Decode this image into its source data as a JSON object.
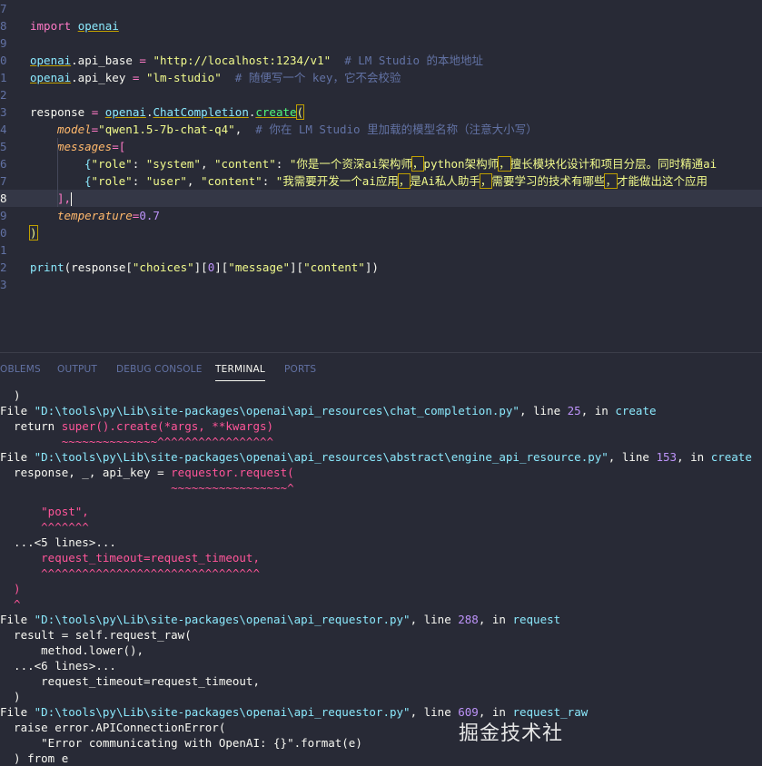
{
  "editor": {
    "lines": [
      {
        "num": "7"
      },
      {
        "num": "8",
        "tokens": {
          "kw": "import",
          "mod": "openai"
        }
      },
      {
        "num": "9"
      },
      {
        "num": "0",
        "tokens": {
          "obj": "openai",
          "attr": ".api_base",
          "eq": " = ",
          "str": "\"http://localhost:1234/v1\"",
          "cmt": "  # LM Studio 的本地地址"
        }
      },
      {
        "num": "1",
        "tokens": {
          "obj": "openai",
          "attr": ".api_key",
          "eq": " = ",
          "str": "\"lm-studio\"",
          "cmt": "  # 随便写一个 key，它不会校验"
        }
      },
      {
        "num": "2"
      },
      {
        "num": "3",
        "tokens": {
          "var": "response",
          "eq": " = ",
          "obj": "openai",
          "dot": ".",
          "cls": "ChatCompletion",
          "dot2": ".",
          "fn": "create",
          "open": "("
        }
      },
      {
        "num": "4",
        "tokens": {
          "param": "model",
          "eq": "=",
          "str": "\"qwen1.5-7b-chat-q4\"",
          "comma": ",",
          "cmt": "  # 你在 LM Studio 里加载的模型名称（注意大小写）"
        }
      },
      {
        "num": "5",
        "tokens": {
          "param": "messages",
          "eq": "=",
          "open": "["
        }
      },
      {
        "num": "6",
        "tokens": {
          "open": "{",
          "k1": "\"role\"",
          "c1": ": ",
          "v1": "\"system\"",
          "s1": ", ",
          "k2": "\"content\"",
          "c2": ": ",
          "v2": "\"你是一个资深ai架构师",
          "v2b": "，",
          "v2c": "python架构师",
          "v2d": "，",
          "v2e": "擅长模块化设计和项目分层。同时精通ai"
        }
      },
      {
        "num": "7",
        "tokens": {
          "open": "{",
          "k1": "\"role\"",
          "c1": ": ",
          "v1": "\"user\"",
          "s1": ", ",
          "k2": "\"content\"",
          "c2": ": ",
          "v2": "\"我需要开发一个ai应用",
          "v2b": "，",
          "v2c": "是Ai私人助手",
          "v2d": "，",
          "v2e": "需要学习的技术有哪些",
          "v2f": "，",
          "v2g": "才能做出这个应用"
        }
      },
      {
        "num": "8",
        "tokens": {
          "close": "],"
        }
      },
      {
        "num": "9",
        "tokens": {
          "param": "temperature",
          "eq": "=",
          "num": "0.7"
        }
      },
      {
        "num": "0",
        "tokens": {
          "close": ")"
        }
      },
      {
        "num": "1"
      },
      {
        "num": "2",
        "tokens": {
          "fn": "print",
          "rest": "(response[",
          "s1": "\"choices\"",
          "b1": "][",
          "n0": "0",
          "b2": "][",
          "s2": "\"message\"",
          "b3": "][",
          "s3": "\"content\"",
          "b4": "])"
        }
      },
      {
        "num": "3"
      }
    ]
  },
  "panel": {
    "tabs": [
      "OBLEMS",
      "OUTPUT",
      "DEBUG CONSOLE",
      "TERMINAL",
      "PORTS"
    ],
    "active_tab": "TERMINAL"
  },
  "terminal": {
    "l1": "  )",
    "l2_a": "File ",
    "l2_path": "\"D:\\tools\\py\\Lib\\site-packages\\openai\\api_resources\\chat_completion.py\"",
    "l2_b": ", line ",
    "l2_num": "25",
    "l2_c": ", in ",
    "l2_fn": "create",
    "l3_a": "  return ",
    "l3_b": "super().create(*args, **kwargs)",
    "l4": "         ~~~~~~~~~~~~~~^^^^^^^^^^^^^^^^^",
    "l5_a": "File ",
    "l5_path": "\"D:\\tools\\py\\Lib\\site-packages\\openai\\api_resources\\abstract\\engine_api_resource.py\"",
    "l5_b": ", line ",
    "l5_num": "153",
    "l5_c": ", in ",
    "l5_fn": "create",
    "l6_a": "  response, _, api_key = ",
    "l6_b": "requestor.request(",
    "l7": "                         ~~~~~~~~~~~~~~~~~^",
    "l8": "      \"post\",",
    "l9": "      ^^^^^^^",
    "l10": "  ...<5 lines>...",
    "l11": "      request_timeout=request_timeout,",
    "l12": "      ^^^^^^^^^^^^^^^^^^^^^^^^^^^^^^^^",
    "l13": "  )",
    "l14": "  ^",
    "l15_a": "File ",
    "l15_path": "\"D:\\tools\\py\\Lib\\site-packages\\openai\\api_requestor.py\"",
    "l15_b": ", line ",
    "l15_num": "288",
    "l15_c": ", in ",
    "l15_fn": "request",
    "l16": "  result = self.request_raw(",
    "l17": "      method.lower(),",
    "l18": "  ...<6 lines>...",
    "l19": "      request_timeout=request_timeout,",
    "l20": "  )",
    "l21_a": "File ",
    "l21_path": "\"D:\\tools\\py\\Lib\\site-packages\\openai\\api_requestor.py\"",
    "l21_b": ", line ",
    "l21_num": "609",
    "l21_c": ", in ",
    "l21_fn": "request_raw",
    "l22": "  raise error.APIConnectionError(",
    "l23": "      \"Error communicating with OpenAI: {}\".format(e)",
    "l24": "  ) from e"
  },
  "watermark": "掘金技术社"
}
